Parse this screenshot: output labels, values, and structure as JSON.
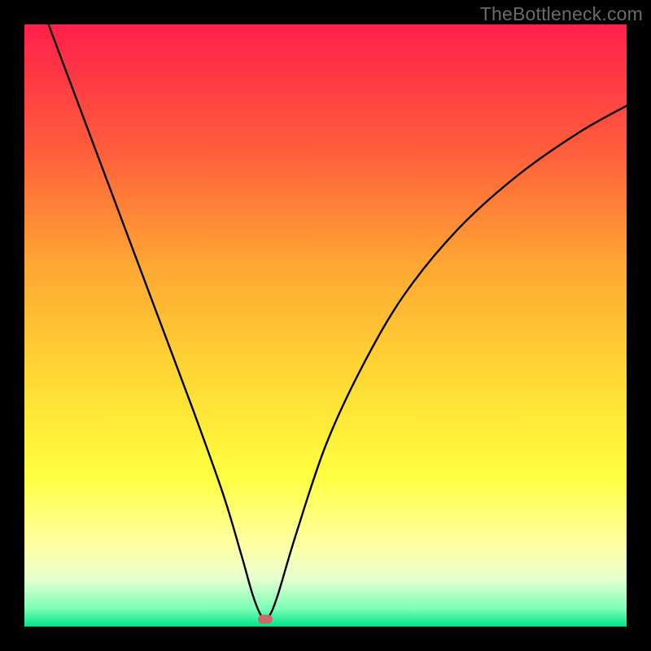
{
  "watermark": "TheBottleneck.com",
  "chart_data": {
    "type": "line",
    "title": "",
    "xlabel": "",
    "ylabel": "",
    "xlim": [
      0,
      100
    ],
    "ylim": [
      0,
      100
    ],
    "grid": false,
    "legend": false,
    "background_gradient_stops": [
      {
        "pct": 0,
        "color": "#ff1f4b"
      },
      {
        "pct": 20,
        "color": "#ff5a3c"
      },
      {
        "pct": 40,
        "color": "#ffa733"
      },
      {
        "pct": 58,
        "color": "#ffd733"
      },
      {
        "pct": 75,
        "color": "#ffff40"
      },
      {
        "pct": 86,
        "color": "#ffffa0"
      },
      {
        "pct": 92,
        "color": "#e7ffcf"
      },
      {
        "pct": 97,
        "color": "#7dffb8"
      },
      {
        "pct": 100,
        "color": "#00e589"
      }
    ],
    "series": [
      {
        "name": "bottleneck-curve",
        "color": "#000000",
        "x": [
          4,
          10,
          16,
          22,
          28,
          33,
          36,
          38,
          39.5,
          40.5,
          42,
          45,
          50,
          56,
          63,
          72,
          82,
          92,
          100
        ],
        "values": [
          100,
          84,
          68,
          52,
          36,
          22,
          12,
          5,
          1.5,
          1.5,
          5,
          15,
          30,
          43,
          55,
          66,
          75,
          82,
          86.5
        ]
      }
    ],
    "marker": {
      "x": 40,
      "y": 1.2,
      "color": "#c96a63"
    }
  }
}
